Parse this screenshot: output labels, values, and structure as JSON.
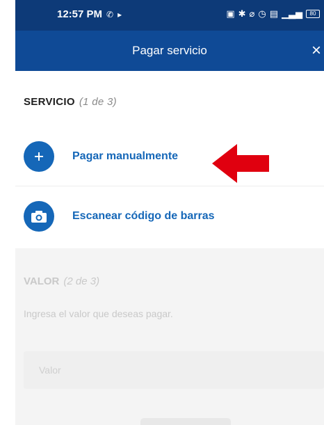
{
  "status_bar": {
    "time": "12:57 PM",
    "icons": [
      "whatsapp-icon",
      "play-icon",
      "nfc-icon",
      "bluetooth-icon",
      "location-off-icon",
      "alarm-icon",
      "email-icon",
      "signal-icon"
    ],
    "battery": "80"
  },
  "header": {
    "title": "Pagar servicio",
    "close_label": "×"
  },
  "service": {
    "title": "SERVICIO",
    "step": "(1 de 3)",
    "options": [
      {
        "label": "Pagar manualmente",
        "icon": "plus-icon"
      },
      {
        "label": "Escanear código de barras",
        "icon": "camera-icon"
      }
    ]
  },
  "value": {
    "title": "VALOR",
    "step": "(2 de 3)",
    "hint": "Ingresa el valor que deseas pagar.",
    "placeholder": "Valor"
  },
  "colors": {
    "header_bg": "#0f4a96",
    "status_bg": "#0d3a78",
    "accent_blue": "#1567b8",
    "arrow_red": "#e0000f"
  }
}
